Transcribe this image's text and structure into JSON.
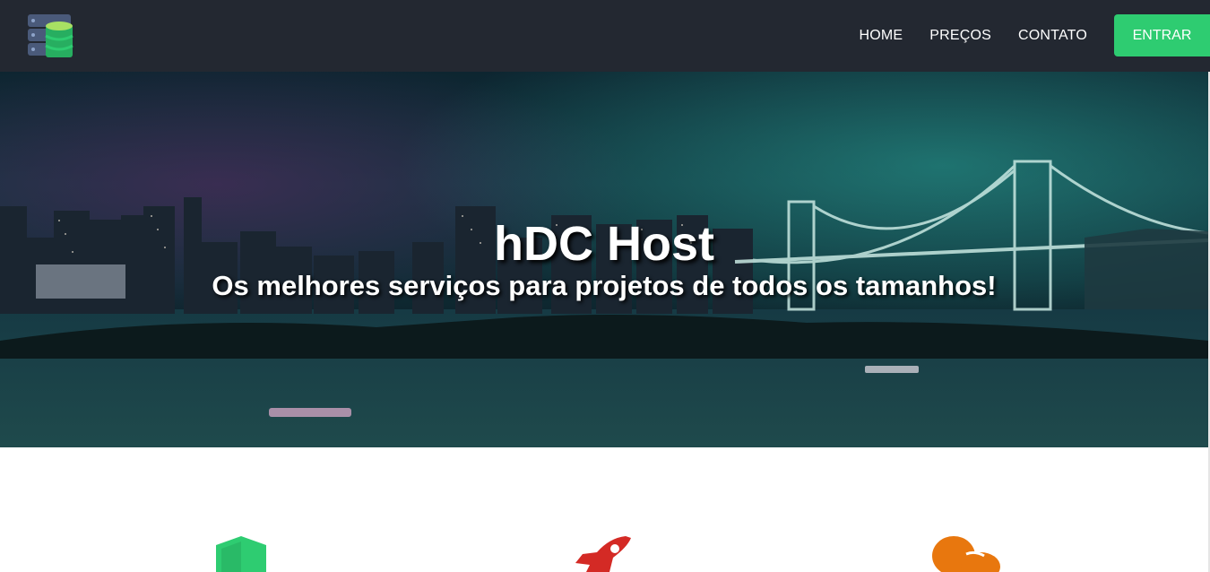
{
  "navbar": {
    "logo_icon": "server-database-icon",
    "links": [
      {
        "label": "HOME"
      },
      {
        "label": "PREÇOS"
      },
      {
        "label": "CONTATO"
      }
    ],
    "login_label": "ENTRAR",
    "colors": {
      "background": "#232831",
      "accent": "#2ecc71"
    }
  },
  "hero": {
    "title": "hDC Host",
    "subtitle": "Os melhores serviços para projetos de todos os tamanhos!",
    "background": "night city skyline with suspension bridge over water"
  },
  "features": {
    "icons": [
      {
        "name": "shield-icon",
        "color": "#2ecc71"
      },
      {
        "name": "rocket-icon",
        "color": "#d42a25"
      },
      {
        "name": "chat-bubbles-icon",
        "color": "#e8770e"
      }
    ]
  }
}
